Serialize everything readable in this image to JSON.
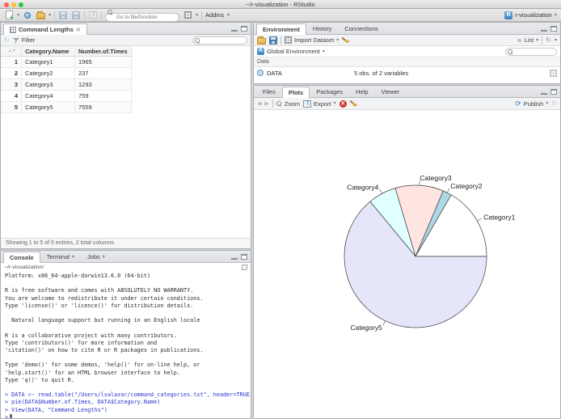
{
  "window": {
    "title": "~/r-visualization - RStudio"
  },
  "main_toolbar": {
    "goto_placeholder": "Go to file/function",
    "addins_label": "Addins",
    "project_label": "r-visualization"
  },
  "viewer_pane": {
    "tab_label": "Command Lengths",
    "filter_label": "Filter",
    "table": {
      "columns": [
        "Category.Name",
        "Number.of.Times"
      ],
      "rows": [
        {
          "index": "1",
          "name": "Category1",
          "times": "1965"
        },
        {
          "index": "2",
          "name": "Category2",
          "times": "237"
        },
        {
          "index": "3",
          "name": "Category3",
          "times": "1293"
        },
        {
          "index": "4",
          "name": "Category4",
          "times": "759"
        },
        {
          "index": "5",
          "name": "Category5",
          "times": "7559"
        }
      ]
    },
    "footer": "Showing 1 to 5 of 5 entries, 2 total columns"
  },
  "console_pane": {
    "tabs": [
      "Console",
      "Terminal",
      "Jobs"
    ],
    "cwd": "~/r-visualization/",
    "input_color": "#2733c9",
    "lines": [
      {
        "text": "Platform: x86_64-apple-darwin13.6.0 (64-bit)",
        "kind": "output"
      },
      {
        "text": "",
        "kind": "output"
      },
      {
        "text": "R is free software and comes with ABSOLUTELY NO WARRANTY.",
        "kind": "output"
      },
      {
        "text": "You are welcome to redistribute it under certain conditions.",
        "kind": "output"
      },
      {
        "text": "Type 'license()' or 'licence()' for distribution details.",
        "kind": "output"
      },
      {
        "text": "",
        "kind": "output"
      },
      {
        "text": "  Natural language support but running in an English locale",
        "kind": "output"
      },
      {
        "text": "",
        "kind": "output"
      },
      {
        "text": "R is a collaborative project with many contributors.",
        "kind": "output"
      },
      {
        "text": "Type 'contributors()' for more information and",
        "kind": "output"
      },
      {
        "text": "'citation()' on how to cite R or R packages in publications.",
        "kind": "output"
      },
      {
        "text": "",
        "kind": "output"
      },
      {
        "text": "Type 'demo()' for some demos, 'help()' for on-line help, or",
        "kind": "output"
      },
      {
        "text": "'help.start()' for an HTML browser interface to help.",
        "kind": "output"
      },
      {
        "text": "Type 'q()' to quit R.",
        "kind": "output"
      },
      {
        "text": "",
        "kind": "output"
      },
      {
        "text": "> DATA <- read.table(\"/Users/lsalazar/command_categories.txt\", header=TRUE)",
        "kind": "input"
      },
      {
        "text": "> pie(DATA$Number.of.Times, DATA$Category.Name)",
        "kind": "input"
      },
      {
        "text": "> View(DATA, \"Command Lengths\")",
        "kind": "input"
      },
      {
        "text": ">",
        "kind": "input",
        "cursor": true
      }
    ]
  },
  "environment_pane": {
    "tabs": [
      "Environment",
      "History",
      "Connections"
    ],
    "import_label": "Import Dataset",
    "list_label": "List",
    "scope_label": "Global Environment",
    "section_label": "Data",
    "object_name": "DATA",
    "object_summary": "5 obs. of 2 variables"
  },
  "plots_pane": {
    "tabs": [
      "Files",
      "Plots",
      "Packages",
      "Help",
      "Viewer"
    ],
    "zoom_label": "Zoom",
    "export_label": "Export",
    "publish_label": "Publish"
  },
  "chart_data": {
    "type": "pie",
    "title": "",
    "categories": [
      "Category1",
      "Category2",
      "Category3",
      "Category4",
      "Category5"
    ],
    "values": [
      1965,
      237,
      1293,
      759,
      7559
    ],
    "colors": [
      "#FFFFFF",
      "#ADD8E6",
      "#FFE4E1",
      "#E0FFFF",
      "#E6E6FA"
    ],
    "stroke_color": "#3c3c3c",
    "start_angle_deg": 0,
    "direction": "counterclockwise",
    "legend": "none",
    "labels_on_slices": true
  }
}
